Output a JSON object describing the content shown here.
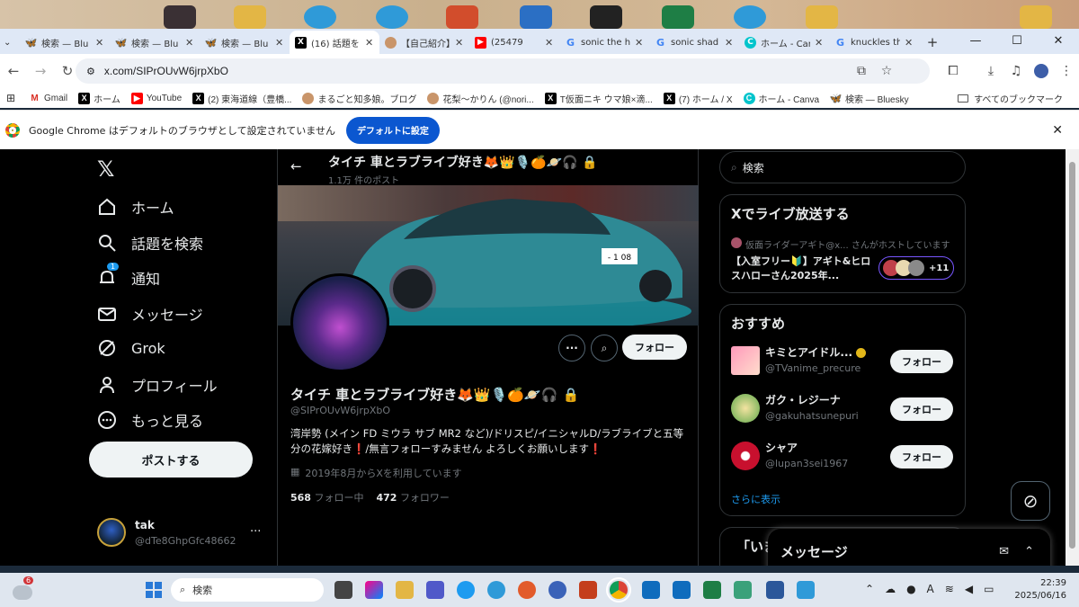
{
  "browser": {
    "tabs": [
      {
        "icon": "bluesky-icon",
        "label": "検索 — Blu"
      },
      {
        "icon": "bluesky-icon",
        "label": "検索 — Blu"
      },
      {
        "icon": "bluesky-icon",
        "label": "検索 — Blu"
      },
      {
        "icon": "x-icon",
        "label": "(16) 話題を",
        "active": true
      },
      {
        "icon": "avatar-icon",
        "label": "【自己紹介】"
      },
      {
        "icon": "youtube-icon",
        "label": "(25479"
      },
      {
        "icon": "google-icon",
        "label": "sonic the h"
      },
      {
        "icon": "google-icon",
        "label": "sonic shad"
      },
      {
        "icon": "canva-icon",
        "label": "ホーム - Can"
      },
      {
        "icon": "google-icon",
        "label": "knuckles th"
      }
    ],
    "new_tab": "+",
    "url": "x.com/SIPrOUvW6jrpXbO",
    "bookmarks": [
      "Gmail",
      "ホーム",
      "YouTube",
      "(2) 東海道線（豊橋...",
      "まるごと知多娘。ブログ",
      "花梨〜かりん (@nori...",
      "T仮面ニキ ウマ娘×滴...",
      "(7) ホーム / X",
      "ホーム - Canva",
      "検索 — Bluesky"
    ],
    "all_bookmarks": "すべてのブックマーク",
    "infobar": {
      "text": "Google Chrome はデフォルトのブラウザとして設定されていません",
      "button": "デフォルトに設定"
    }
  },
  "x": {
    "nav": [
      "ホーム",
      "話題を検索",
      "通知",
      "メッセージ",
      "Grok",
      "プロフィール",
      "もっと見る"
    ],
    "notif_count": "1",
    "post_button": "ポストする",
    "account": {
      "name": "tak",
      "handle": "@dTe8GhpGfc48662"
    },
    "profile": {
      "header_name": "タイチ 車とラブライブ好き🦊👑🎙️🍊🪐🎧",
      "post_count": "1.1万 件のポスト",
      "name": "タイチ 車とラブライブ好き🦊👑🎙️🍊🪐🎧",
      "handle": "@SIPrOUvW6jrpXbO",
      "bio": "湾岸勢 (メイン FD ミウラ サブ MR2 など)/ドリスピ/イニシャルD/ラブライブと五等分の花嫁好き❗/無言フォローすみません よろしくお願いします❗",
      "joined": "2019年8月からXを利用しています",
      "following_count": "568",
      "following_label": "フォロー中",
      "followers_count": "472",
      "followers_label": "フォロワー",
      "follow_button": "フォロー",
      "more_icon": "···",
      "car_plate": "- 1 08"
    },
    "search_placeholder": "検索",
    "live": {
      "title": "Xでライブ放送する",
      "host_line": "仮面ライダーアギト@x... さんがホストしています",
      "space_title": "【入室フリー🔰】アギト&ヒロスハローさん2025年...",
      "extra": "+11"
    },
    "recommend": {
      "title": "おすすめ",
      "users": [
        {
          "name": "キミとアイドル...",
          "handle": "@TVanime_precure",
          "button": "フォロー"
        },
        {
          "name": "ガク・レジーナ",
          "handle": "@gakuhatsunepuri",
          "button": "フォロー"
        },
        {
          "name": "シャア",
          "handle": "@lupan3sei1967",
          "button": "フォロー"
        }
      ],
      "show_more": "さらに表示"
    },
    "next_section": "「いま",
    "messages_drawer": "メッセージ"
  },
  "taskbar": {
    "weather_badge": "6",
    "search_placeholder": "検索",
    "time": "22:39",
    "date": "2025/06/16"
  }
}
